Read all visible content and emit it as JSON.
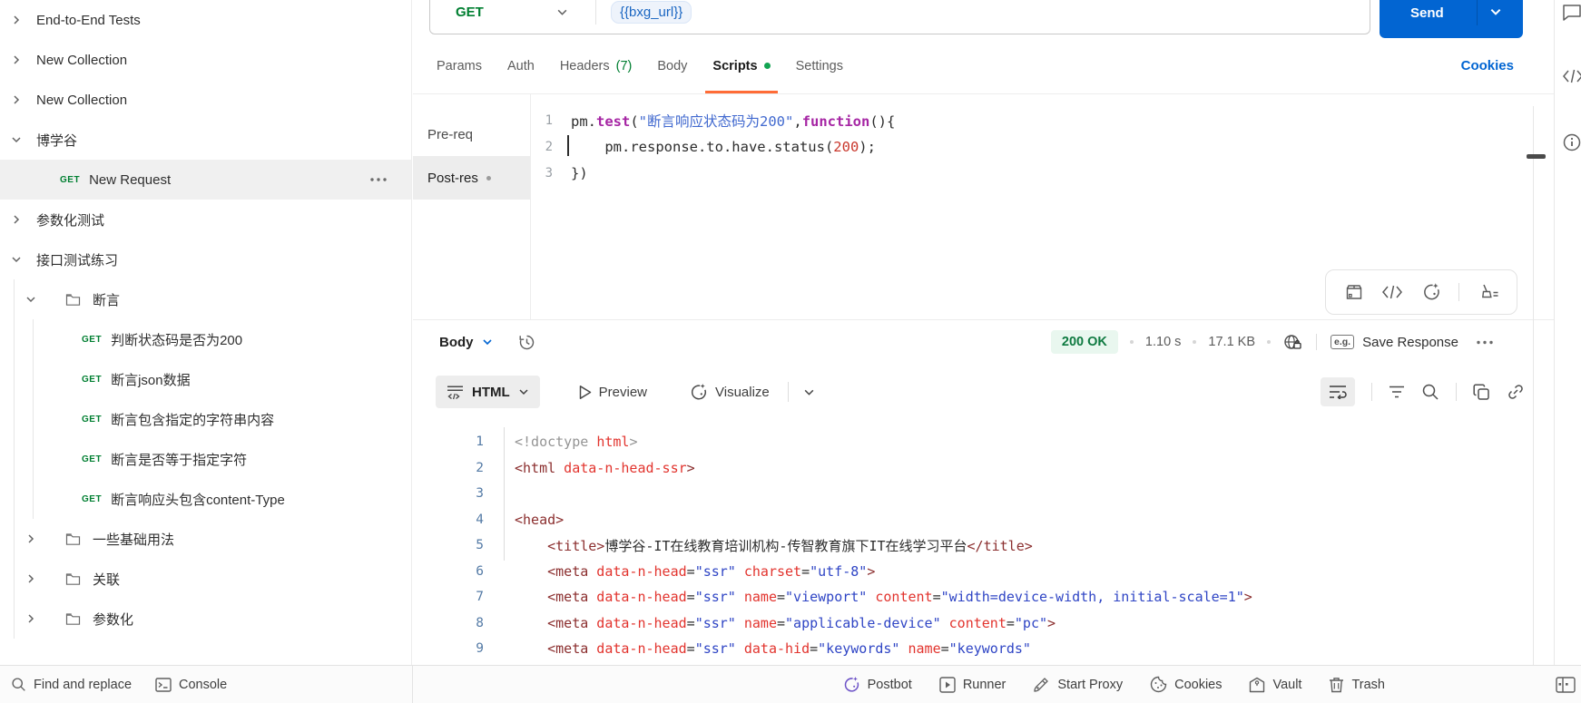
{
  "colors": {
    "accent_orange": "#ff6c37",
    "method_green": "#007f31",
    "primary_blue": "#0265d2",
    "status_green": "#0f7a41"
  },
  "sidebar": {
    "items": [
      {
        "label": "End-to-End Tests"
      },
      {
        "label": "New Collection"
      },
      {
        "label": "New Collection"
      },
      {
        "label": "博学谷"
      },
      {
        "method": "GET",
        "label": "New Request"
      },
      {
        "label": "参数化测试"
      },
      {
        "label": "接口测试练习"
      },
      {
        "label": "断言"
      },
      {
        "method": "GET",
        "label": "判断状态码是否为200"
      },
      {
        "method": "GET",
        "label": "断言json数据"
      },
      {
        "method": "GET",
        "label": "断言包含指定的字符串内容"
      },
      {
        "method": "GET",
        "label": "断言是否等于指定字符"
      },
      {
        "method": "GET",
        "label": "断言响应头包含content-Type"
      },
      {
        "label": "一些基础用法"
      },
      {
        "label": "关联"
      },
      {
        "label": "参数化"
      }
    ]
  },
  "request": {
    "method": "GET",
    "url": "{{bxg_url}}",
    "send": "Send",
    "cookies": "Cookies",
    "tabs": [
      {
        "label": "Params"
      },
      {
        "label": "Auth"
      },
      {
        "label": "Headers",
        "count": "(7)"
      },
      {
        "label": "Body"
      },
      {
        "label": "Scripts"
      },
      {
        "label": "Settings"
      }
    ]
  },
  "script_editor": {
    "pre_tab": "Pre-req",
    "post_tab": "Post-res",
    "code": [
      {
        "n": "1",
        "t": [
          [
            "pl",
            "pm."
          ],
          [
            "kw",
            "test"
          ],
          [
            "pl",
            "("
          ],
          [
            "str",
            "\"断言响应状态码为200\""
          ],
          [
            "pl",
            ","
          ],
          [
            "kw",
            "function"
          ],
          [
            "pl",
            "(){"
          ]
        ]
      },
      {
        "n": "2",
        "t": [
          [
            "pl",
            "    pm.response.to.have.status("
          ],
          [
            "num",
            "200"
          ],
          [
            "pl",
            ");"
          ]
        ]
      },
      {
        "n": "3",
        "t": [
          [
            "pl",
            "})"
          ]
        ]
      }
    ]
  },
  "response": {
    "body_tab": "Body",
    "status": "200 OK",
    "time": "1.10 s",
    "size": "17.1 KB",
    "eg": "e.g.",
    "save": "Save Response",
    "format": "HTML",
    "preview": "Preview",
    "visualize": "Visualize",
    "code": [
      {
        "n": "1",
        "t": [
          [
            "gray",
            "<!doctype "
          ],
          [
            "attr",
            "html"
          ],
          [
            "gray",
            ">"
          ]
        ]
      },
      {
        "n": "2",
        "t": [
          [
            "tag",
            "<html"
          ],
          [
            "attr",
            " data-n-head-ssr"
          ],
          [
            "tag",
            ">"
          ]
        ]
      },
      {
        "n": "3",
        "t": []
      },
      {
        "n": "4",
        "t": [
          [
            "tag",
            "<head>"
          ]
        ]
      },
      {
        "n": "5",
        "t": [
          [
            "pl",
            "    "
          ],
          [
            "tag",
            "<title>"
          ],
          [
            "pl",
            "博学谷-IT在线教育培训机构-传智教育旗下IT在线学习平台"
          ],
          [
            "tag",
            "</title>"
          ]
        ]
      },
      {
        "n": "6",
        "t": [
          [
            "pl",
            "    "
          ],
          [
            "tag",
            "<meta"
          ],
          [
            "attr",
            " data-n-head"
          ],
          [
            "pl",
            "="
          ],
          [
            "val",
            "\"ssr\""
          ],
          [
            "attr",
            " charset"
          ],
          [
            "pl",
            "="
          ],
          [
            "val",
            "\"utf-8\""
          ],
          [
            "tag",
            ">"
          ]
        ]
      },
      {
        "n": "7",
        "t": [
          [
            "pl",
            "    "
          ],
          [
            "tag",
            "<meta"
          ],
          [
            "attr",
            " data-n-head"
          ],
          [
            "pl",
            "="
          ],
          [
            "val",
            "\"ssr\""
          ],
          [
            "attr",
            " name"
          ],
          [
            "pl",
            "="
          ],
          [
            "val",
            "\"viewport\""
          ],
          [
            "attr",
            " content"
          ],
          [
            "pl",
            "="
          ],
          [
            "val",
            "\"width=device-width, initial-scale=1\""
          ],
          [
            "tag",
            ">"
          ]
        ]
      },
      {
        "n": "8",
        "t": [
          [
            "pl",
            "    "
          ],
          [
            "tag",
            "<meta"
          ],
          [
            "attr",
            " data-n-head"
          ],
          [
            "pl",
            "="
          ],
          [
            "val",
            "\"ssr\""
          ],
          [
            "attr",
            " name"
          ],
          [
            "pl",
            "="
          ],
          [
            "val",
            "\"applicable-device\""
          ],
          [
            "attr",
            " content"
          ],
          [
            "pl",
            "="
          ],
          [
            "val",
            "\"pc\""
          ],
          [
            "tag",
            ">"
          ]
        ]
      },
      {
        "n": "9",
        "t": [
          [
            "pl",
            "    "
          ],
          [
            "tag",
            "<meta"
          ],
          [
            "attr",
            " data-n-head"
          ],
          [
            "pl",
            "="
          ],
          [
            "val",
            "\"ssr\""
          ],
          [
            "attr",
            " data-hid"
          ],
          [
            "pl",
            "="
          ],
          [
            "val",
            "\"keywords\""
          ],
          [
            "attr",
            " name"
          ],
          [
            "pl",
            "="
          ],
          [
            "val",
            "\"keywords\""
          ]
        ]
      }
    ]
  },
  "status_bar": {
    "find": "Find and replace",
    "console": "Console",
    "postbot": "Postbot",
    "runner": "Runner",
    "proxy": "Start Proxy",
    "cookies": "Cookies",
    "vault": "Vault",
    "trash": "Trash"
  }
}
